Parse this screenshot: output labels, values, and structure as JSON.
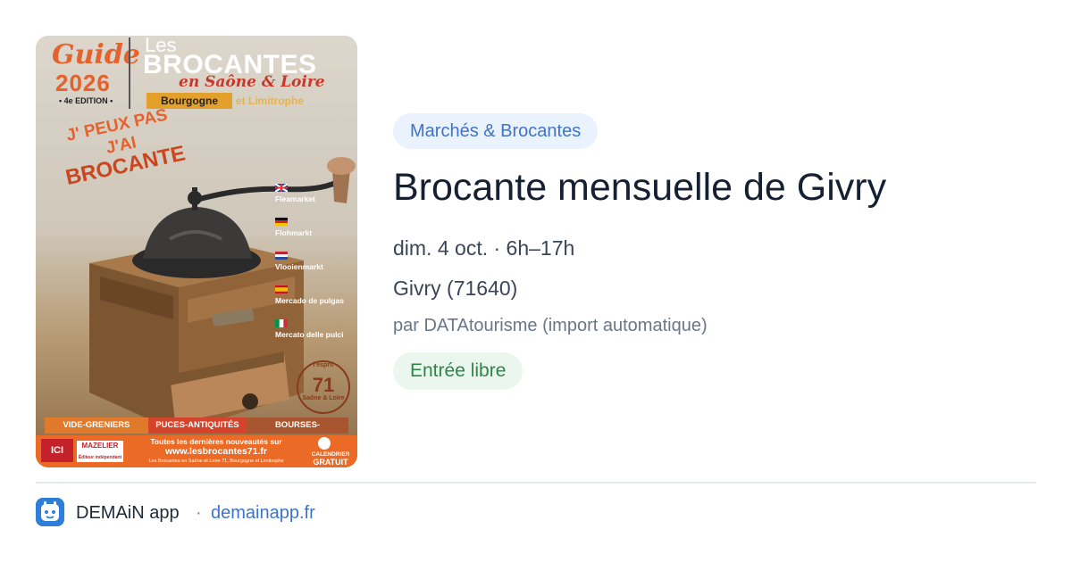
{
  "poster": {
    "guide_label": "Guide",
    "year": "2026",
    "edition": "• 4e EDITION •",
    "brand_les": "Les",
    "brand_name": "BROCANTES",
    "region": "en Saône & Loire",
    "area_main": "Bourgogne",
    "area_rest": "et Limitrophe",
    "slogan_line1": "J' PEUX PAS",
    "slogan_line2": "J'AI",
    "slogan_line3": "BROCANTE",
    "markets": [
      "Fleamarket",
      "Flohmarkt",
      "Vlooienmarkt",
      "Mercado de pulgas",
      "Mercato delle pulci"
    ],
    "seal_top": "l'esprit",
    "seal_number": "71",
    "seal_bottom": "Saône & Loire",
    "categories": [
      "VIDE-GRENIERS",
      "PUCES-ANTIQUITÉS",
      "BOURSES-COLLECTIONS"
    ],
    "ici_logo": "ICI",
    "mazelier_name": "MAZELIER",
    "mazelier_tagline": "Éditeur indépendant",
    "news_text": "Toutes les dernières nouveautés sur",
    "website": "www.lesbrocantes71.fr",
    "facebook": "Les Brocantes en Saône et Loire 71, Bourgogne et Limitrophe",
    "calendar_label": "CALENDRIER",
    "calendar_free": "GRATUIT"
  },
  "event": {
    "category": "Marchés & Brocantes",
    "title": "Brocante mensuelle de Givry",
    "date_time": "dim. 4 oct. · 6h–17h",
    "place": "Givry (71640)",
    "source": "par DATAtourisme (import automatique)",
    "price": "Entrée libre"
  },
  "footer": {
    "app_name": "DEMAiN app",
    "separator": "·",
    "domain": "demainapp.fr"
  }
}
